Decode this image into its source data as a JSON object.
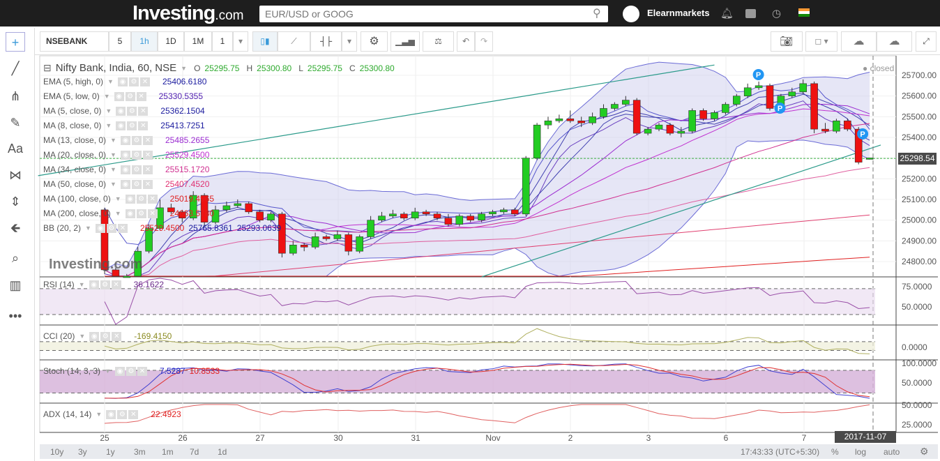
{
  "nav": {
    "logo": "Investing",
    "logo_suffix": ".com",
    "search_placeholder": "EUR/USD or GOOG",
    "user": "Elearnmarkets",
    "icons": [
      "search-icon",
      "bell-icon",
      "portfolio-icon",
      "clock-icon",
      "india-flag-icon"
    ]
  },
  "left_tools": [
    "crosshair-icon",
    "trendline-icon",
    "fib-icon",
    "brush-icon",
    "text-icon",
    "pattern-icon",
    "measure-icon",
    "arrow-left-icon",
    "zoom-icon",
    "indicator-icon",
    "more-icon"
  ],
  "left_tool_labels": [
    "+",
    "╱",
    "⋔",
    "✎",
    "Aa",
    "⋈",
    "⇕",
    "🡸",
    "⌕",
    "▥",
    "•••"
  ],
  "toolbar": {
    "symbol": "NSEBANK",
    "intervals": [
      "5",
      "1h",
      "1D",
      "1M",
      "1"
    ],
    "active_interval": "1h"
  },
  "legend": {
    "title": "Nifty Bank, India, 60, NSE",
    "ohlc": {
      "o_label": "O",
      "o": "25295.75",
      "h_label": "H",
      "h": "25300.80",
      "l_label": "L",
      "l": "25295.75",
      "c_label": "C",
      "c": "25300.80"
    },
    "studies": [
      {
        "name": "EMA (5, high, 0)",
        "values": [
          "25406.6180"
        ],
        "colors": [
          "#1a1a9e"
        ]
      },
      {
        "name": "EMA (5, low, 0)",
        "values": [
          "25330.5355"
        ],
        "colors": [
          "#5020b0"
        ]
      },
      {
        "name": "MA (5, close, 0)",
        "values": [
          "25362.1504"
        ],
        "colors": [
          "#1a1a9e"
        ]
      },
      {
        "name": "MA (8, close, 0)",
        "values": [
          "25413.7251"
        ],
        "colors": [
          "#1a1a9e"
        ]
      },
      {
        "name": "MA (13, close, 0)",
        "values": [
          "25485.2655"
        ],
        "colors": [
          "#9a2bd0"
        ]
      },
      {
        "name": "MA (20, close, 0)",
        "values": [
          "25529.4500"
        ],
        "colors": [
          "#c030d0"
        ]
      },
      {
        "name": "MA (34, close, 0)",
        "values": [
          "25515.1720"
        ],
        "colors": [
          "#d03090"
        ]
      },
      {
        "name": "MA (50, close, 0)",
        "values": [
          "25407.4520"
        ],
        "colors": [
          "#e03070"
        ]
      },
      {
        "name": "MA (100, close, 0)",
        "values": [
          "25019.4965"
        ],
        "colors": [
          "#e02020"
        ]
      },
      {
        "name": "MA (200, close, 0)",
        "values": [
          "24663.5780"
        ],
        "colors": [
          "#e02020"
        ]
      },
      {
        "name": "BB (20, 2)",
        "values": [
          "25529.4500",
          "25765.8361",
          "25293.0639"
        ],
        "colors": [
          "#e02020",
          "#1a1a9e",
          "#1a1a9e"
        ]
      }
    ],
    "status": "closed"
  },
  "indicators": [
    {
      "name": "RSI (14)",
      "values": [
        "36.1622"
      ],
      "colors": [
        "#6a2a8a"
      ],
      "ticks": [
        "75.0000",
        "50.0000"
      ]
    },
    {
      "name": "CCI (20)",
      "values": [
        "-169.4150"
      ],
      "colors": [
        "#8a8a20"
      ],
      "ticks": [
        "0.0000"
      ]
    },
    {
      "name": "Stoch (14, 3, 3)",
      "values": [
        "7.5287",
        "10.8533"
      ],
      "colors": [
        "#2020c0",
        "#e02020"
      ],
      "ticks": [
        "100.0000",
        "50.0000"
      ]
    },
    {
      "name": "ADX (14, 14)",
      "values": [
        "22.4923"
      ],
      "colors": [
        "#e02020"
      ],
      "ticks": [
        "50.0000",
        "25.0000"
      ]
    }
  ],
  "price_axis": [
    "25700.00",
    "25600.00",
    "25500.00",
    "25400.00",
    "25300.00",
    "25200.00",
    "25100.00",
    "25000.00",
    "24900.00",
    "24800.00"
  ],
  "current_price": "25298.54",
  "time_axis": [
    "25",
    "26",
    "27",
    "30",
    "31",
    "Nov",
    "2",
    "3",
    "6",
    "7"
  ],
  "crosshair_date": "2017-11-07 15:30",
  "watermark": "Investing.com",
  "bottom": {
    "ranges": [
      "10y",
      "3y",
      "1y",
      "3m",
      "1m",
      "7d",
      "1d"
    ],
    "clock": "17:43:33 (UTC+5:30)",
    "percent": "%",
    "log": "log",
    "auto": "auto"
  },
  "chart_data": {
    "type": "candlestick",
    "title": "Nifty Bank, India, 60, NSE",
    "x_ticks": [
      "25",
      "26",
      "27",
      "30",
      "31",
      "Nov",
      "2",
      "3",
      "6",
      "7"
    ],
    "bars_per_day": 7,
    "ylim": [
      24700,
      25780
    ],
    "ohlc": [
      [
        25050,
        25060,
        24740,
        24760
      ],
      [
        24760,
        24770,
        24680,
        24700
      ],
      [
        24700,
        24740,
        24690,
        24720
      ],
      [
        24720,
        24870,
        24710,
        24850
      ],
      [
        24850,
        24980,
        24840,
        24960
      ],
      [
        24960,
        25100,
        24950,
        25060
      ],
      [
        25060,
        25080,
        25030,
        25040
      ],
      [
        25040,
        25050,
        24990,
        25010
      ],
      [
        25010,
        25140,
        25000,
        25120
      ],
      [
        25120,
        25130,
        24970,
        24990
      ],
      [
        24990,
        25070,
        24980,
        25050
      ],
      [
        25050,
        25090,
        25040,
        25070
      ],
      [
        25070,
        25100,
        25060,
        25080
      ],
      [
        25080,
        25090,
        25030,
        25040
      ],
      [
        25040,
        25050,
        24990,
        25000
      ],
      [
        25000,
        25040,
        24990,
        25030
      ],
      [
        25030,
        25040,
        24820,
        24840
      ],
      [
        24840,
        24900,
        24830,
        24880
      ],
      [
        24880,
        24890,
        24850,
        24870
      ],
      [
        24870,
        24940,
        24860,
        24920
      ],
      [
        24920,
        24930,
        24900,
        24910
      ],
      [
        24910,
        24950,
        24900,
        24930
      ],
      [
        24930,
        24940,
        24830,
        24850
      ],
      [
        24850,
        24930,
        24840,
        24920
      ],
      [
        24920,
        25020,
        24910,
        25000
      ],
      [
        25000,
        25040,
        24990,
        25020
      ],
      [
        25020,
        25050,
        25010,
        25030
      ],
      [
        25030,
        25040,
        25000,
        25010
      ],
      [
        25010,
        25060,
        25000,
        25040
      ],
      [
        25040,
        25050,
        25020,
        25030
      ],
      [
        25030,
        25040,
        25000,
        25010
      ],
      [
        25010,
        25030,
        24970,
        24980
      ],
      [
        24980,
        25030,
        24970,
        25020
      ],
      [
        25020,
        25030,
        24990,
        25000
      ],
      [
        25000,
        25040,
        24990,
        25030
      ],
      [
        25030,
        25050,
        25020,
        25040
      ],
      [
        25040,
        25060,
        25030,
        25050
      ],
      [
        25050,
        25060,
        25020,
        25030
      ],
      [
        25030,
        25310,
        25020,
        25300
      ],
      [
        25300,
        25470,
        25290,
        25460
      ],
      [
        25460,
        25500,
        25440,
        25480
      ],
      [
        25480,
        25510,
        25470,
        25490
      ],
      [
        25490,
        25530,
        25470,
        25480
      ],
      [
        25480,
        25500,
        25450,
        25470
      ],
      [
        25470,
        25520,
        25460,
        25500
      ],
      [
        25500,
        25560,
        25490,
        25540
      ],
      [
        25540,
        25570,
        25530,
        25560
      ],
      [
        25560,
        25600,
        25550,
        25580
      ],
      [
        25580,
        25590,
        25410,
        25420
      ],
      [
        25420,
        25450,
        25410,
        25440
      ],
      [
        25440,
        25470,
        25430,
        25460
      ],
      [
        25460,
        25470,
        25410,
        25420
      ],
      [
        25420,
        25450,
        25400,
        25430
      ],
      [
        25430,
        25540,
        25420,
        25530
      ],
      [
        25530,
        25540,
        25480,
        25490
      ],
      [
        25490,
        25530,
        25480,
        25520
      ],
      [
        25520,
        25570,
        25510,
        25560
      ],
      [
        25560,
        25610,
        25550,
        25600
      ],
      [
        25600,
        25660,
        25590,
        25640
      ],
      [
        25640,
        25670,
        25630,
        25650
      ],
      [
        25650,
        25660,
        25530,
        25540
      ],
      [
        25540,
        25610,
        25530,
        25600
      ],
      [
        25600,
        25640,
        25590,
        25620
      ],
      [
        25620,
        25680,
        25610,
        25660
      ],
      [
        25660,
        25670,
        25420,
        25440
      ],
      [
        25440,
        25470,
        25420,
        25430
      ],
      [
        25430,
        25490,
        25420,
        25480
      ],
      [
        25480,
        25490,
        25430,
        25440
      ],
      [
        25440,
        25450,
        25270,
        25280
      ],
      [
        25295.75,
        25300.8,
        25295.75,
        25300.8
      ]
    ],
    "trendlines": [
      {
        "from": [
          -6,
          25215
        ],
        "to": [
          55,
          25750
        ],
        "color": "#2a9a8a"
      },
      {
        "from": [
          34,
          24726
        ],
        "to": [
          70,
          25363
        ],
        "color": "#2a9a8a"
      }
    ],
    "horizontal_line": {
      "price": 25298.54,
      "color": "#3cb043"
    },
    "markers": [
      {
        "bar": 64,
        "label": "P"
      },
      {
        "bar": 65,
        "label": "P"
      },
      {
        "bar": 69,
        "label": "P"
      }
    ],
    "colors": {
      "up": "#22cc22",
      "down": "#ee1111",
      "bb_fill": "#c8c8ea",
      "bb_line": "#6b6bd6"
    }
  }
}
